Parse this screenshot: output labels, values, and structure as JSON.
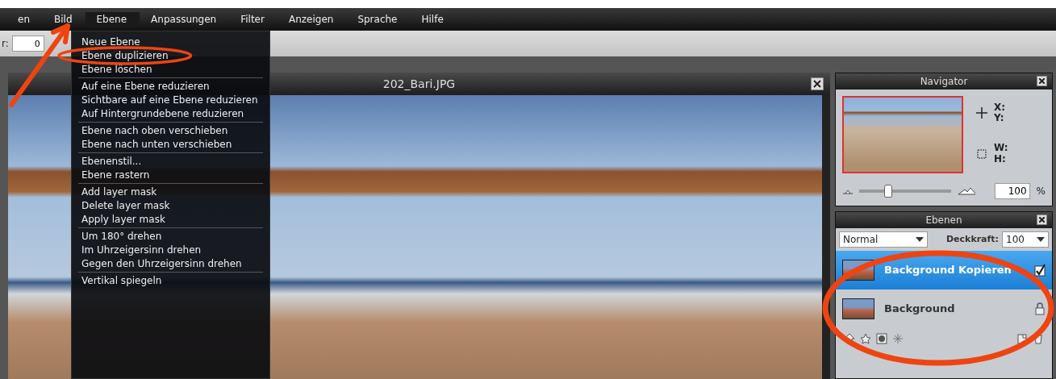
{
  "menubar": [
    {
      "label": "en",
      "open": false
    },
    {
      "label": "Bild",
      "open": false
    },
    {
      "label": "Ebene",
      "open": true
    },
    {
      "label": "Anpassungen",
      "open": false
    },
    {
      "label": "Filter",
      "open": false
    },
    {
      "label": "Anzeigen",
      "open": false
    },
    {
      "label": "Sprache",
      "open": false
    },
    {
      "label": "Hilfe",
      "open": false
    }
  ],
  "toolbar": {
    "label": "r:",
    "value": "0"
  },
  "menu": {
    "groups": [
      [
        "Neue Ebene",
        "Ebene duplizieren",
        "Ebene löschen"
      ],
      [
        "Auf eine Ebene reduzieren",
        "Sichtbare auf eine Ebene reduzieren",
        "Auf Hintergrundebene reduzieren"
      ],
      [
        "Ebene nach oben verschieben",
        "Ebene nach unten verschieben"
      ],
      [
        "Ebenenstil...",
        "Ebene rastern"
      ],
      [
        "Add layer mask",
        "Delete layer mask",
        "Apply layer mask"
      ],
      [
        "Um 180° drehen",
        "Im Uhrzeigersinn drehen",
        "Gegen den Uhrzeigersinn drehen"
      ],
      [
        "Vertikal spiegeln"
      ]
    ]
  },
  "document": {
    "title": "202_Bari.JPG"
  },
  "navigator": {
    "title": "Navigator",
    "x": "X:",
    "y": "Y:",
    "w": "W:",
    "h": "H:",
    "zoom": {
      "level": 0.3,
      "value": "100",
      "unit": "%"
    }
  },
  "layers": {
    "title": "Ebenen",
    "blend": "Normal",
    "opacity_label": "Deckkraft:",
    "opacity": "100",
    "items": [
      {
        "name": "Background Kopieren",
        "selected": true,
        "locked": false,
        "visible": true
      },
      {
        "name": "Background",
        "selected": false,
        "locked": true
      }
    ]
  }
}
